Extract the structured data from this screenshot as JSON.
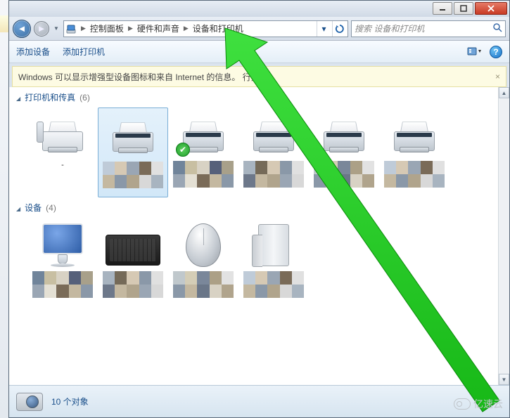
{
  "titlebar": {
    "min": "min",
    "max": "max",
    "close": "close"
  },
  "breadcrumb": {
    "root_icon": "devices-icon",
    "segments": [
      "控制面板",
      "硬件和声音",
      "设备和打印机"
    ]
  },
  "search": {
    "placeholder": "搜索 设备和打印机"
  },
  "toolbar": {
    "add_device": "添加设备",
    "add_printer": "添加打印机"
  },
  "infostrip": {
    "text": "Windows 可以显示增强型设备图标和来自 Internet 的信息。                           行更改...",
    "close": "×"
  },
  "groups": {
    "printers": {
      "title": "打印机和传真",
      "count": "(6)"
    },
    "devices": {
      "title": "设备",
      "count": "(4)"
    }
  },
  "items": {
    "fax_label": "-"
  },
  "details": {
    "count_text": "10 个对象"
  },
  "watermark": {
    "text": "亿速云"
  },
  "blur_palettes": {
    "a": [
      "#bfcbd8",
      "#d6c9b4",
      "#9aa6b4",
      "#7a6b58",
      "#e0e0e0",
      "#c4b8a0",
      "#8a98a8",
      "#b0a48c",
      "#d8d8d8",
      "#a8b4c0"
    ],
    "b": [
      "#70849a",
      "#c8bfa2",
      "#d8d2c4",
      "#56607a",
      "#a8a08a",
      "#9aa6b4",
      "#e4e0d4",
      "#7a6b58",
      "#c4b8a0",
      "#8a98a8"
    ],
    "c": [
      "#a8b4c0",
      "#756a58",
      "#d6c9b4",
      "#8a98a8",
      "#e0e0e0",
      "#6d788a",
      "#c4b8a0",
      "#b0a48c",
      "#9aa6b4",
      "#d8d8d8"
    ],
    "d": [
      "#c0c8cc",
      "#d4cdb6",
      "#7a879a",
      "#aca086",
      "#e2e2e2",
      "#8a98a8",
      "#c4b8a0",
      "#6a7688",
      "#d8d2c4",
      "#b0a48c"
    ]
  }
}
